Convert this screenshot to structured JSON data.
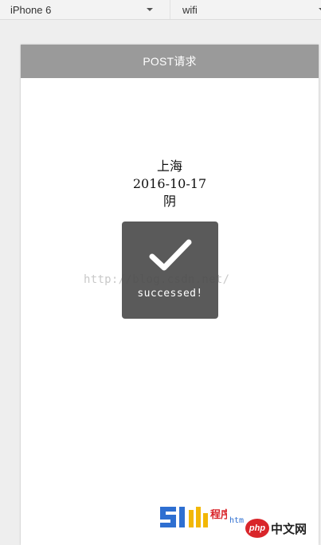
{
  "toolbar": {
    "device": "iPhone 6",
    "network": "wifi"
  },
  "app": {
    "title": "POST请求"
  },
  "result": {
    "city": "上海",
    "date": "2016-10-17",
    "weather": "阴"
  },
  "toast": {
    "icon": "checkmark-icon",
    "message": "successed!"
  },
  "watermark": {
    "text": "http://blog.csdn.net/"
  },
  "logos": {
    "site_51": "51",
    "site_51_chars": "程序",
    "site_51_sub": "htm",
    "php_badge": "php",
    "php_text": "中文网"
  },
  "colors": {
    "header": "#9a9a9a",
    "toast": "#4c4c4c",
    "logo_blue": "#2e6fd1",
    "logo_yellow": "#f2b705",
    "logo_red": "#d9252a"
  }
}
